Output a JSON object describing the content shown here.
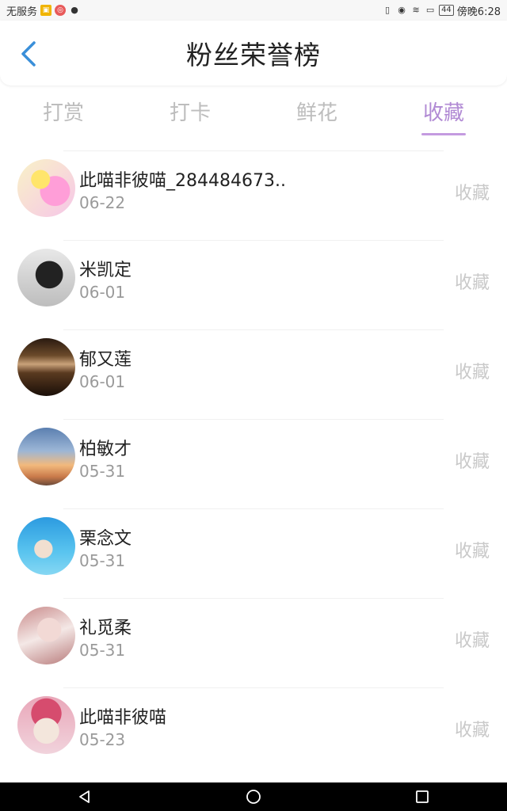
{
  "status_bar": {
    "carrier": "无服务",
    "battery": "44",
    "time": "傍晚6:28"
  },
  "header": {
    "title": "粉丝荣誉榜",
    "back_icon": "chevron-left-icon"
  },
  "tabs": [
    {
      "label": "打赏",
      "active": false
    },
    {
      "label": "打卡",
      "active": false
    },
    {
      "label": "鲜花",
      "active": false
    },
    {
      "label": "收藏",
      "active": true
    }
  ],
  "colors": {
    "accent": "#b18ad4",
    "back_icon": "#3a8fd9",
    "inactive_tab": "#bdbdbd"
  },
  "list": [
    {
      "name": "此喵非彼喵_284484673..",
      "date": "06-22",
      "action": "收藏"
    },
    {
      "name": "米凯定",
      "date": "06-01",
      "action": "收藏"
    },
    {
      "name": "郁又莲",
      "date": "06-01",
      "action": "收藏"
    },
    {
      "name": "柏敏才",
      "date": "05-31",
      "action": "收藏"
    },
    {
      "name": "栗念文",
      "date": "05-31",
      "action": "收藏"
    },
    {
      "name": "礼觅柔",
      "date": "05-31",
      "action": "收藏"
    },
    {
      "name": "此喵非彼喵",
      "date": "05-23",
      "action": "收藏"
    }
  ],
  "nav_bar": {
    "icons": [
      "back-triangle-icon",
      "home-circle-icon",
      "recent-square-icon"
    ]
  }
}
